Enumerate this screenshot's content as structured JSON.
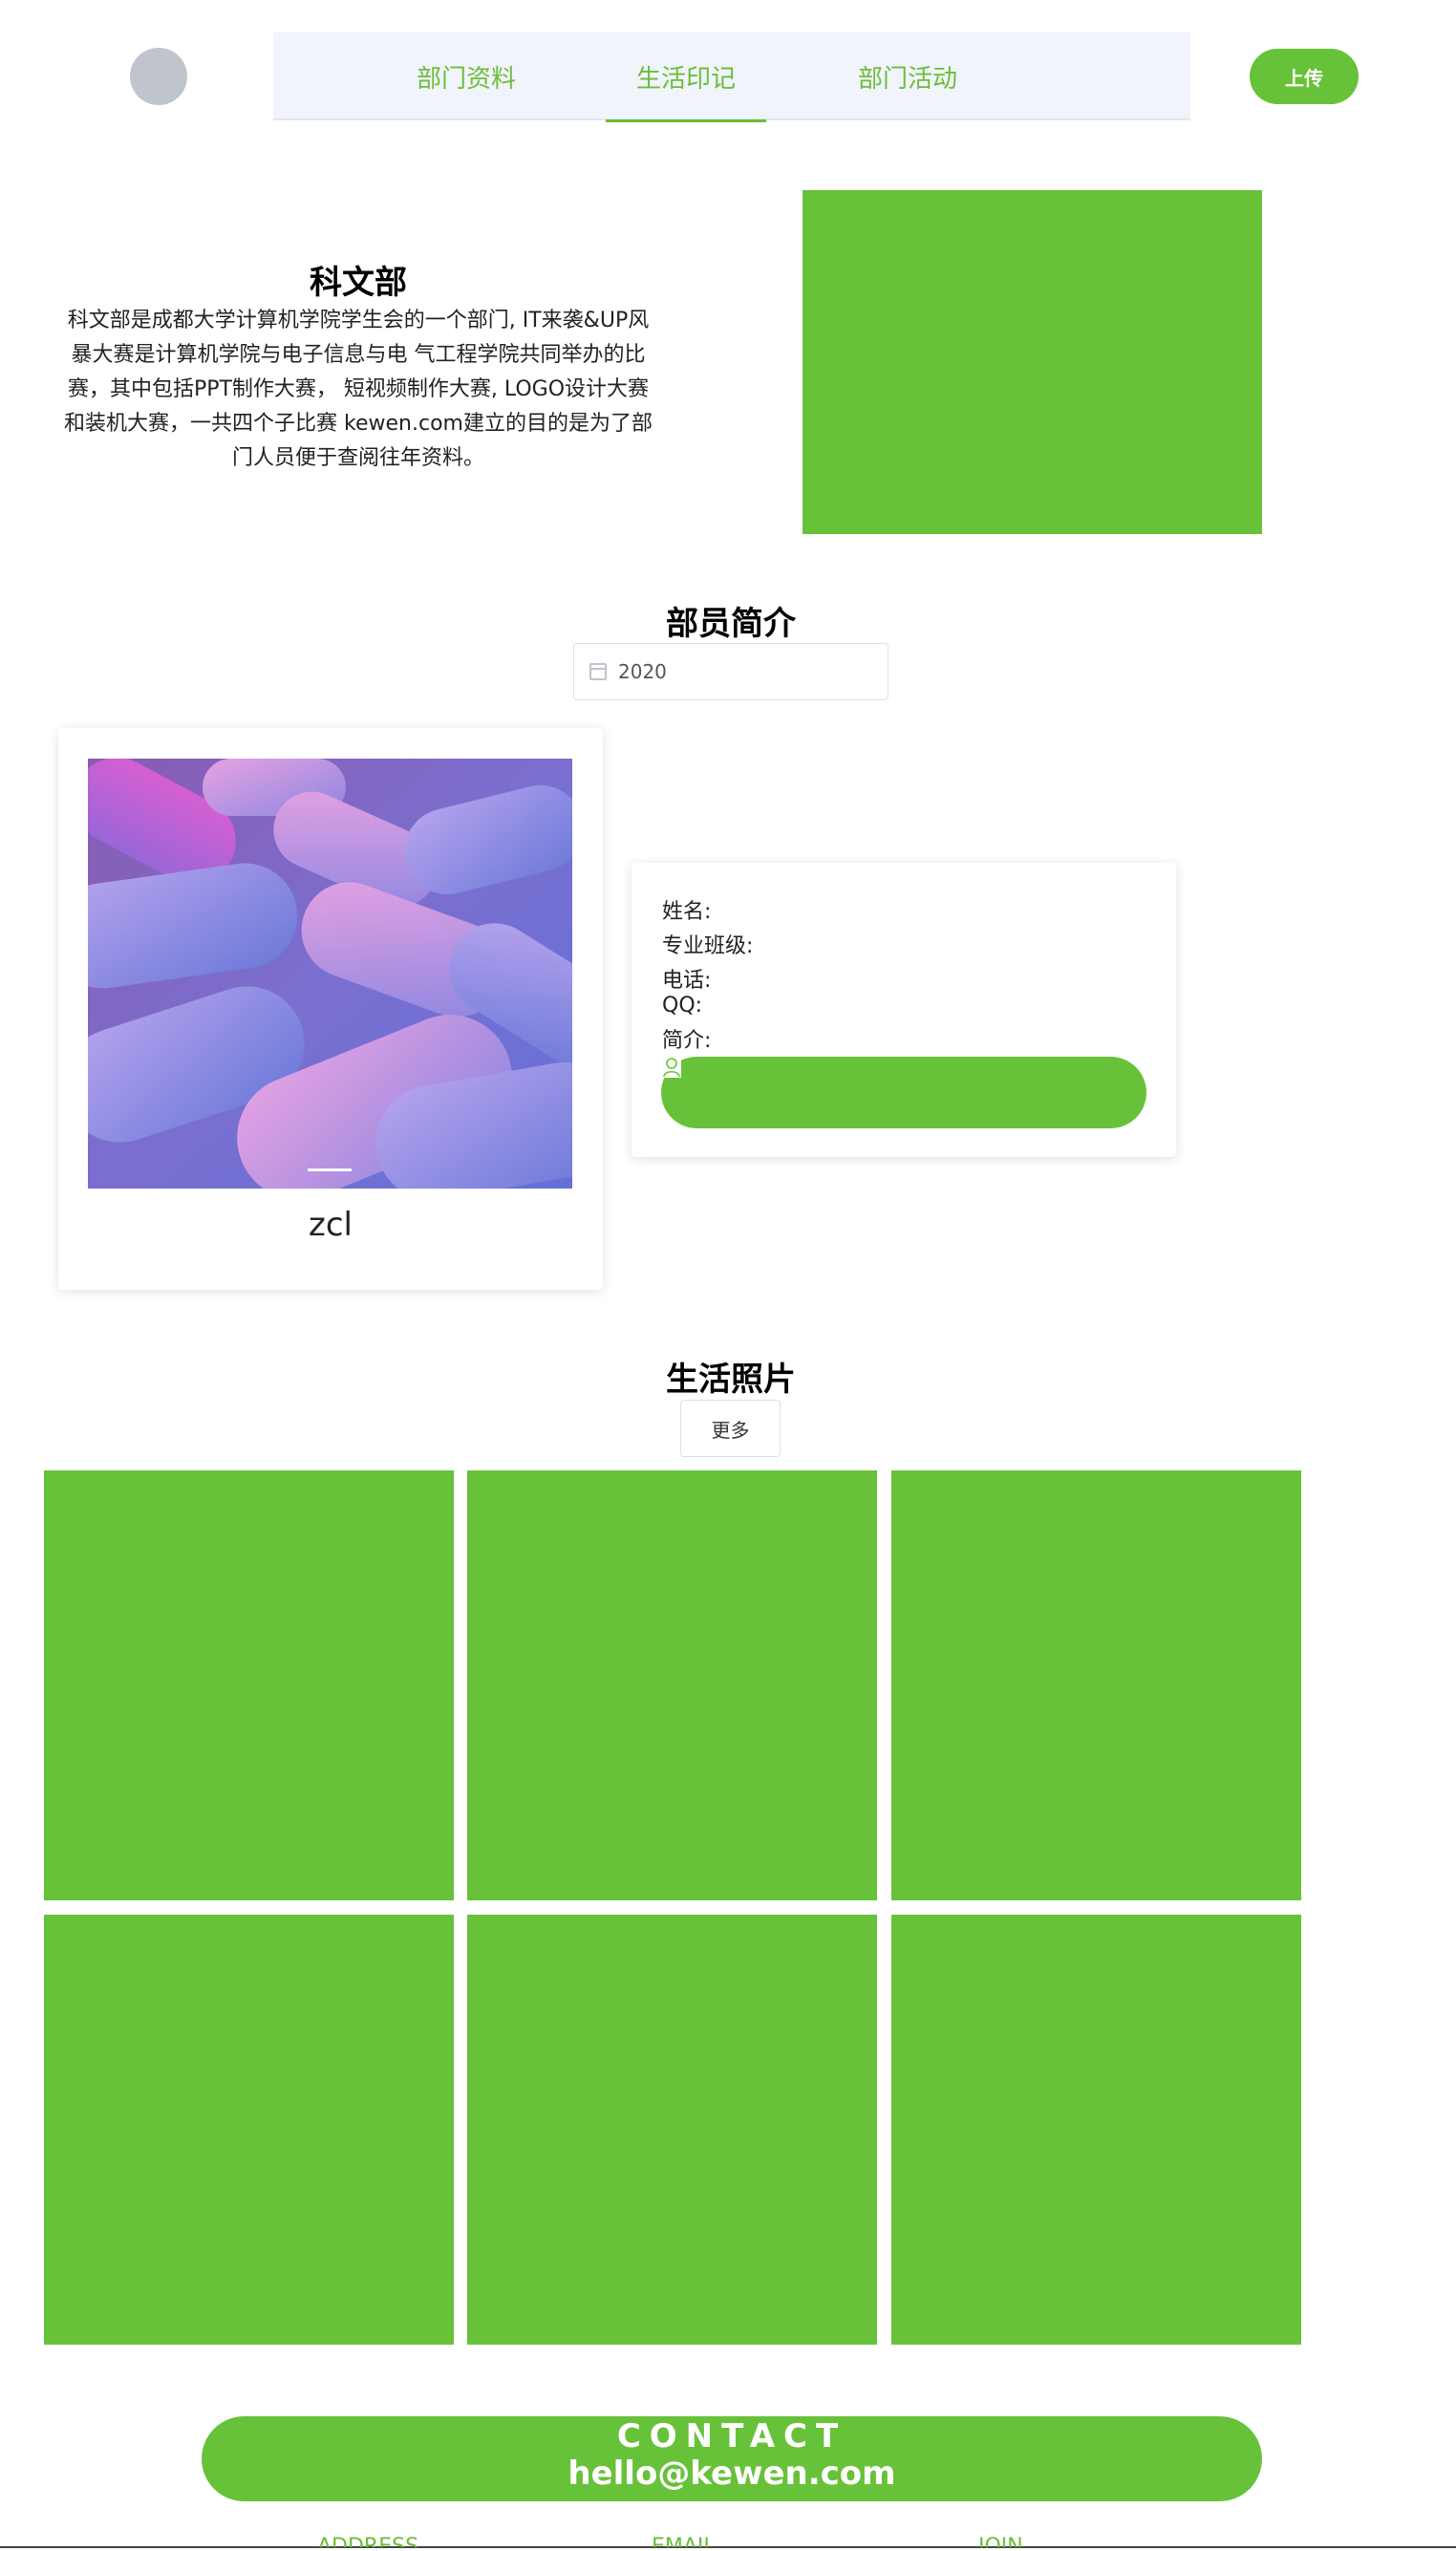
{
  "header": {
    "tabs": [
      {
        "label": "部门资料",
        "active": false
      },
      {
        "label": "生活印记",
        "active": true
      },
      {
        "label": "部门活动",
        "active": false
      }
    ],
    "upload_label": "上传"
  },
  "intro": {
    "title": "科文部",
    "description": "科文部是成都大学计算机学院学生会的一个部门, IT来袭&UP风暴大赛是计算机学院与电子信息与电 气工程学院共同举办的比赛，其中包括PPT制作大赛， 短视频制作大赛, LOGO设计大赛和装机大赛，一共四个子比赛 kewen.com建立的目的是为了部门人员便于查阅往年资料。"
  },
  "members": {
    "section_title": "部员简介",
    "year": "2020",
    "card": {
      "name": "zcl"
    },
    "info": {
      "name_label": "姓名:",
      "class_label": "专业班级:",
      "phone_label": "电话:",
      "qq_label": "QQ:",
      "intro_label": "简介:"
    }
  },
  "life": {
    "section_title": "生活照片",
    "more_label": "更多"
  },
  "footer": {
    "contact_title": "CONTACT",
    "contact_email": "hello@kewen.com",
    "links": [
      "ADDRESS",
      "EMAIL",
      "JOIN"
    ]
  },
  "colors": {
    "accent": "#67c23a",
    "nav_bg": "#f1f4fb",
    "avatar": "#c0c4cc"
  }
}
